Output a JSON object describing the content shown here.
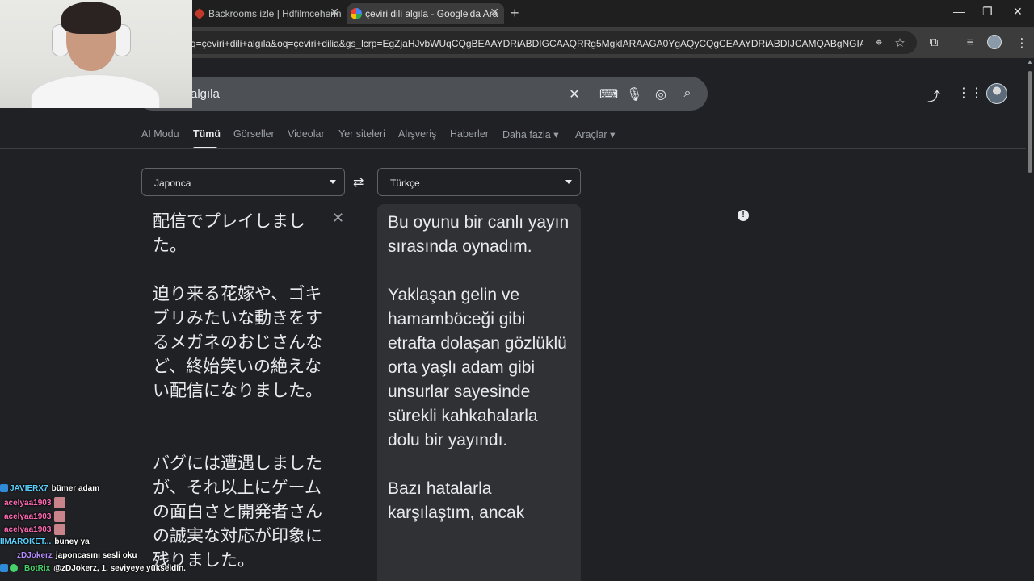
{
  "browser": {
    "tabs": [
      {
        "title": "Backrooms izle | Hdfilmcehenn",
        "active": false
      },
      {
        "title": "çeviri dili algıla - Google'da Ara",
        "active": true
      }
    ],
    "url": "q=çeviri+dili+algıla&oq=çeviri+dilia&gs_lcrp=EgZjaHJvbWUqCQgBEAAYDRiABDIGCAAQRRg5MgkIARAAGA0YgAQyCQgCEAAYDRiABDIJCAMQABgNGIAEMgkIB..."
  },
  "search": {
    "query_visible": "algıla",
    "icons": [
      "clear-icon",
      "keyboard-icon",
      "mic-icon",
      "lens-icon",
      "search-icon"
    ]
  },
  "nav": {
    "tabs": [
      "AI Modu",
      "Tümü",
      "Görseller",
      "Videolar",
      "Yer siteleri",
      "Alışveriş",
      "Haberler",
      "Daha fazla",
      "Araçlar"
    ],
    "active": "Tümü"
  },
  "translate": {
    "source_lang": "Japonca",
    "target_lang": "Türkçe",
    "source_text": "配信でプレイしました。\n\n迫り来る花嫁や、ゴキブリみたいな動きをするメガネのおじさんなど、終始笑いの絶えない配信になりました。\n\n\nバグには遭遇しましたが、それ以上にゲームの面白さと開発者さんの誠実な対応が印象に残りました。",
    "target_text": "Bu oyunu bir canlı yayın sırasında oynadım.\n\nYaklaşan gelin ve hamamböceği gibi etrafta dolaşan gözlüklü orta yaşlı adam gibi unsurlar sayesinde sürekli kahkahalarla dolu bir yayındı.\n\nBazı hatalarla karşılaştım, ancak"
  },
  "chat": [
    {
      "user": "JAVIERX7",
      "msg": "bümer adam",
      "color": "#5ad1ff",
      "emote": false
    },
    {
      "user": "acelyaa1903",
      "msg": "",
      "color": "#ff69b4",
      "emote": true
    },
    {
      "user": "acelyaa1903",
      "msg": "",
      "color": "#ff69b4",
      "emote": true
    },
    {
      "user": "acelyaa1903",
      "msg": "",
      "color": "#ff69b4",
      "emote": true
    },
    {
      "user": "IIMAROKET...",
      "msg": "buney ya",
      "color": "#5ad1ff",
      "emote": false
    },
    {
      "user": "zDJokerz",
      "msg": "japoncasını sesli oku",
      "color": "#b58cff",
      "emote": false
    },
    {
      "user": "BotRix",
      "msg": "@zDJokerz, 1. seviyeye yükseldin.",
      "color": "#47d16a",
      "emote": false
    }
  ],
  "colors": {
    "background": "#202124",
    "surface": "#303134",
    "text": "#e8eaed",
    "muted": "#9aa0a6"
  }
}
